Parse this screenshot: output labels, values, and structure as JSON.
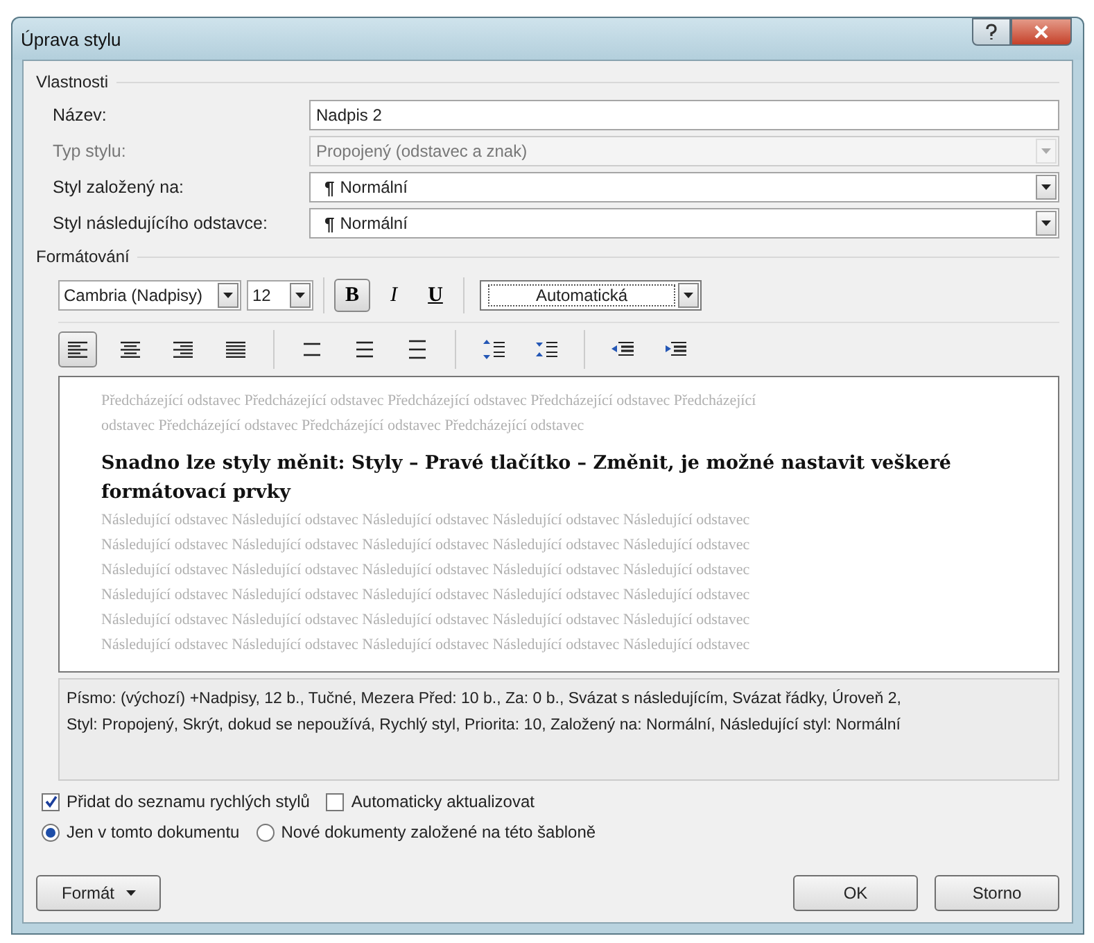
{
  "window": {
    "title": "Úprava stylu"
  },
  "properties": {
    "legend": "Vlastnosti",
    "fields": [
      {
        "label": "Název:",
        "kind": "text",
        "value": "Nadpis 2",
        "disabled": false
      },
      {
        "label": "Typ stylu:",
        "kind": "dropdown",
        "value": "Propojený (odstavec a znak)",
        "disabled": true
      },
      {
        "label": "Styl založený na:",
        "kind": "dropdown",
        "mark": "¶",
        "value": "Normální",
        "disabled": false
      },
      {
        "label": "Styl následujícího odstavce:",
        "kind": "dropdown",
        "mark": "¶",
        "value": "Normální",
        "disabled": false
      }
    ]
  },
  "formatting": {
    "legend": "Formátování",
    "font": "Cambria (Nadpisy)",
    "size": "12",
    "style_buttons": [
      {
        "label": "B",
        "kind": "bold",
        "on": true
      },
      {
        "label": "I",
        "kind": "italic",
        "on": false
      },
      {
        "label": "U",
        "kind": "underline",
        "on": false
      }
    ],
    "font_color_label": "Automatická",
    "paragraph_buttons": [
      {
        "kind": "align-left",
        "selected": true
      },
      {
        "kind": "align-center",
        "selected": false
      },
      {
        "kind": "align-right",
        "selected": false
      },
      {
        "kind": "justify",
        "selected": false
      },
      {
        "kind": "spacing-single",
        "selected": false
      },
      {
        "kind": "spacing-one-half",
        "selected": false
      },
      {
        "kind": "spacing-double",
        "selected": false
      },
      {
        "kind": "space-increase",
        "selected": false
      },
      {
        "kind": "space-decrease",
        "selected": false
      },
      {
        "kind": "indent-decrease",
        "selected": false
      },
      {
        "kind": "indent-increase",
        "selected": false
      }
    ]
  },
  "preview": {
    "before": [
      "Předcházející odstavec Předcházející odstavec Předcházející odstavec Předcházející odstavec Předcházející",
      "odstavec Předcházející odstavec Předcházející odstavec Předcházející odstavec"
    ],
    "heading": "Snadno lze styly měnit: Styly – Pravé tlačítko – Změnit, je možné nastavit veškeré formátovací prvky",
    "after": [
      "Následující odstavec Následující odstavec Následující odstavec Následující odstavec Následující odstavec",
      "Následující odstavec Následující odstavec Následující odstavec Následující odstavec Následující odstavec",
      "Následující odstavec Následující odstavec Následující odstavec Následující odstavec Následující odstavec",
      "Následující odstavec Následující odstavec Následující odstavec Následující odstavec Následující odstavec",
      "Následující odstavec Následující odstavec Následující odstavec Následující odstavec Následující odstavec",
      "Následující odstavec Následující odstavec Následující odstavec Následující odstavec Následující odstavec"
    ]
  },
  "description": [
    "Písmo: (výchozí) +Nadpisy, 12 b., Tučné, Mezera Před:  10 b., Za:  0 b., Svázat s následujícím, Svázat řádky, Úroveň 2,",
    "Styl: Propojený, Skrýt, dokud se nepoužívá, Rychlý styl, Priorita:  10, Založený na: Normální, Následující styl: Normální"
  ],
  "checkboxes": [
    {
      "label": "Přidat do seznamu rychlých stylů",
      "checked": true
    },
    {
      "label": "Automaticky aktualizovat",
      "checked": false
    }
  ],
  "radios": [
    {
      "label": "Jen v tomto dokumentu",
      "selected": true
    },
    {
      "label": "Nové dokumenty založené na této šabloně",
      "selected": false
    }
  ],
  "buttons": {
    "format": "Formát",
    "ok": "OK",
    "cancel": "Storno"
  }
}
